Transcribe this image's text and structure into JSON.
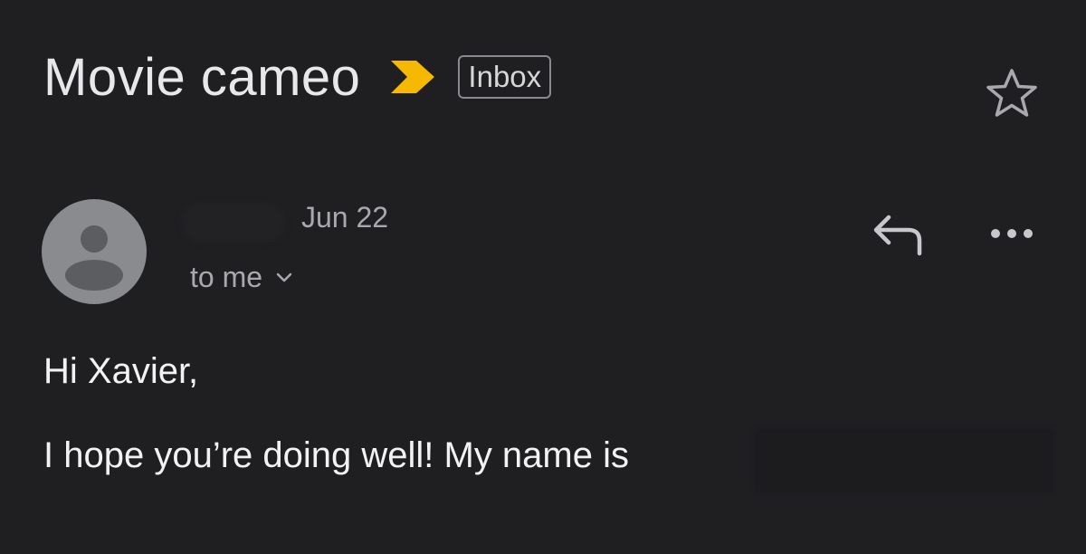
{
  "email": {
    "subject": "Movie cameo",
    "label": "Inbox",
    "date": "Jun 22",
    "recipient": "to me",
    "greeting": "Hi Xavier,",
    "body_line1": "I hope you’re doing well! My name is"
  },
  "colors": {
    "background": "#1f1f22",
    "importance_marker": "#f6b800",
    "avatar": "#8a8b8f"
  },
  "icons": {
    "importance": "importance-marker-icon",
    "star": "star-icon",
    "reply": "reply-icon",
    "more": "more-options-icon",
    "chevron": "chevron-down-icon",
    "avatar": "person-icon"
  }
}
